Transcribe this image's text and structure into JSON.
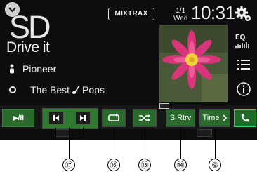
{
  "source": {
    "name": "SD"
  },
  "track": {
    "title": "Drive it",
    "artist": "Pioneer",
    "album": "The Best ",
    "album_suffix": "Pops"
  },
  "header": {
    "mixtrax": "MIXTRAX",
    "date_day": "1/1",
    "date_weekday": "Wed",
    "time": "10:31"
  },
  "side": {
    "eq_label": "EQ"
  },
  "controls": {
    "play_pause": "▶/II",
    "repeat": "",
    "shuffle": "",
    "srtrv": "S.Rtrv",
    "time": "Time"
  },
  "callouts": [
    "⑰",
    "⑯",
    "⑮",
    "⑭",
    "⑨"
  ],
  "colors": {
    "button_green": "#2a6b2d",
    "screen_bg": "#0d0d0f"
  }
}
